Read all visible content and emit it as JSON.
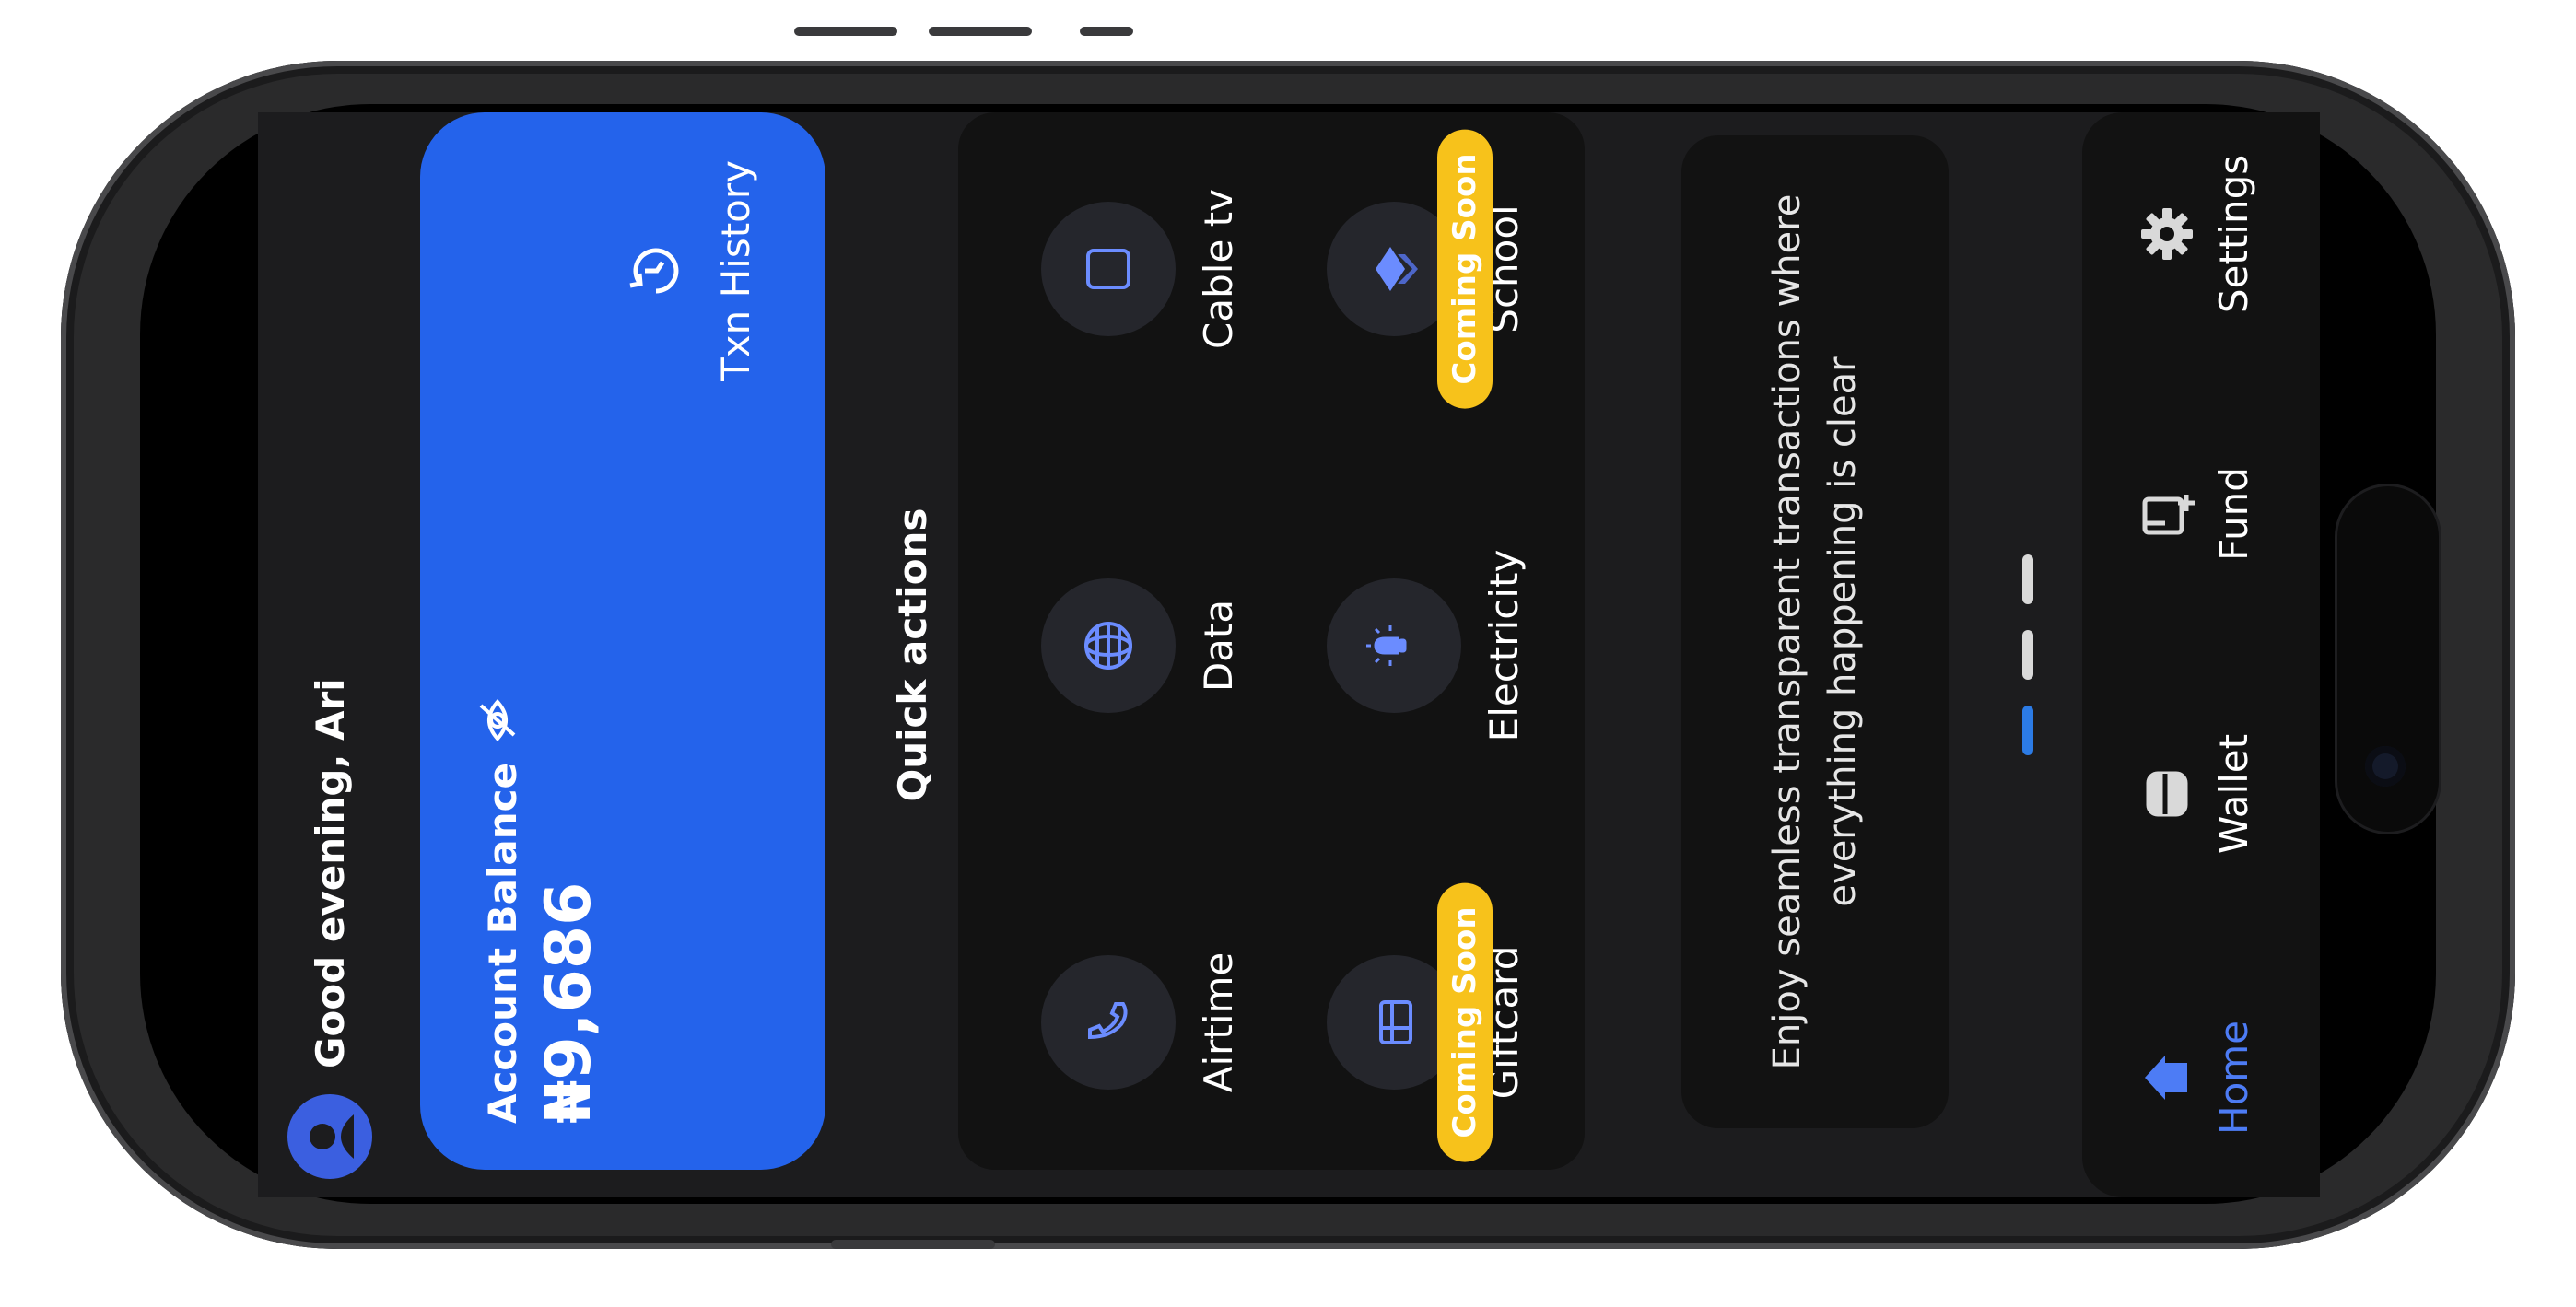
{
  "header": {
    "greeting": "Good evening, Ari",
    "avatar_icon": "user-avatar-icon"
  },
  "balance": {
    "label": "Account Balance",
    "value": "₦9,686",
    "visibility_icon": "eye-off-icon"
  },
  "txn_history": {
    "label": "Txn History",
    "icon": "history-icon"
  },
  "quick_actions": {
    "title": "Quick actions",
    "badge": "Coming Soon",
    "items": [
      {
        "label": "Airtime",
        "icon": "phone-icon"
      },
      {
        "label": "Data",
        "icon": "globe-icon"
      },
      {
        "label": "Cable tv",
        "icon": "tv-icon"
      },
      {
        "label": "Giftcard",
        "icon": "giftcard-icon"
      },
      {
        "label": "Electricity",
        "icon": "bulb-icon"
      },
      {
        "label": "School",
        "icon": "school-icon"
      }
    ]
  },
  "banner": {
    "text": "Enjoy seamless transparent transactions where everything happening is clear"
  },
  "carousel": {
    "pages": 3,
    "active": 1
  },
  "nav": {
    "items": [
      {
        "label": "Home",
        "icon": "home-icon"
      },
      {
        "label": "Wallet",
        "icon": "wallet-icon"
      },
      {
        "label": "Fund",
        "icon": "fund-icon"
      },
      {
        "label": "Settings",
        "icon": "gear-icon"
      }
    ],
    "active": "Home"
  },
  "colors": {
    "accent": "#2463eb",
    "badge": "#f7c21b",
    "nav_active": "#4d7cf5",
    "icon": "#6b8cff"
  }
}
